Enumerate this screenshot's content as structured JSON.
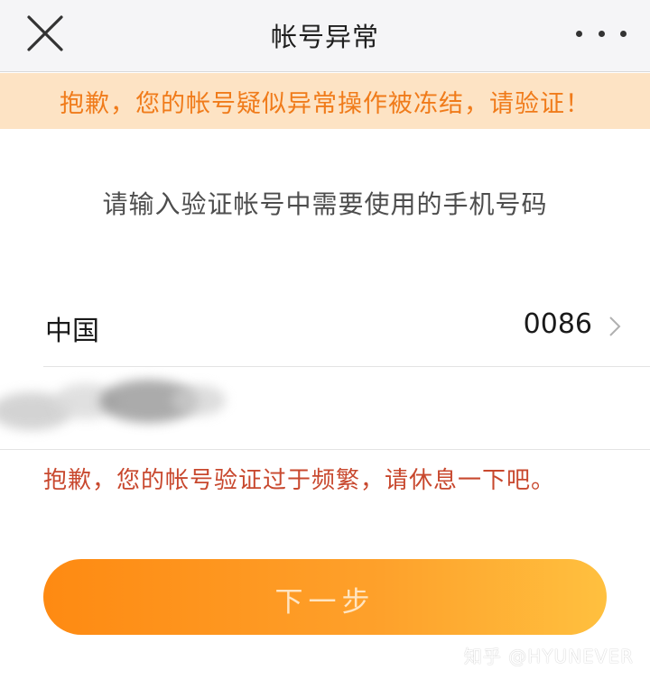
{
  "header": {
    "close_icon": "close-icon",
    "title": "帐号异常",
    "more_icon": "more-dots-icon"
  },
  "banner": {
    "message": "抱歉，您的帐号疑似异常操作被冻结，请验证！",
    "color": "#f07b1a",
    "background": "#fde3c4"
  },
  "form": {
    "instruction": "请输入验证帐号中需要使用的手机号码",
    "country": {
      "name": "中国",
      "code": "0086",
      "chevron_icon": "chevron-right-icon"
    },
    "phone_field": {
      "value_state": "redacted"
    },
    "error": "抱歉，您的帐号验证过于频繁，请休息一下吧。",
    "error_color": "#c8482e"
  },
  "action": {
    "next_label": "下一步",
    "gradient_start": "#fe8a12",
    "gradient_end": "#ffc03f"
  },
  "watermark": "知乎 @HYUNEVER"
}
